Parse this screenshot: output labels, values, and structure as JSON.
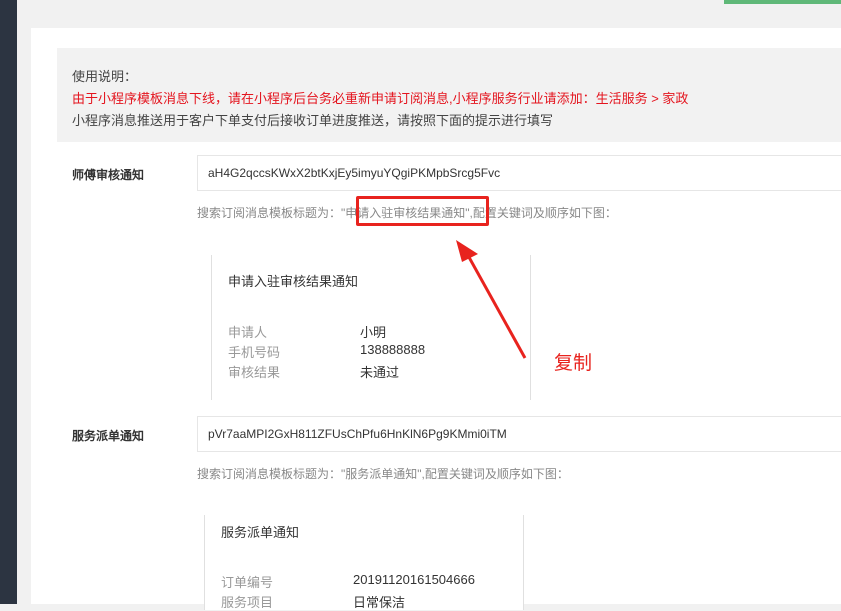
{
  "notice": {
    "line1": "使用说明：",
    "line2": "由于小程序模板消息下线，请在小程序后台务必重新申请订阅消息,小程序服务行业请添加：生活服务 > 家政",
    "line3": "小程序消息推送用于客户下单支付后接收订单进度推送，请按照下面的提示进行填写"
  },
  "audit": {
    "label": "师傅审核通知",
    "template_id": "aH4G2qccsKWxX2btKxjEy5imyuYQgiPKMpbSrcg5Fvc",
    "hint_prefix": "搜索订阅消息模板标题为：",
    "hint_title": "\"申请入驻审核结果通知\"",
    "hint_suffix": ",配置关键词及顺序如下图：",
    "card": {
      "title": "申请入驻审核结果通知",
      "rows": [
        {
          "key": "申请人",
          "value": "小明"
        },
        {
          "key": "手机号码",
          "value": "138888888"
        },
        {
          "key": "审核结果",
          "value": "未通过"
        }
      ]
    }
  },
  "dispatch": {
    "label": "服务派单通知",
    "template_id": "pVr7aaMPI2GxH811ZFUsChPfu6HnKlN6Pg9KMmi0iTM",
    "hint": "搜索订阅消息模板标题为：\"服务派单通知\",配置关键词及顺序如下图：",
    "card": {
      "title": "服务派单通知",
      "rows": [
        {
          "key": "订单编号",
          "value": "20191120161504666"
        },
        {
          "key": "服务项目",
          "value": "日常保洁"
        }
      ]
    }
  },
  "annotation": {
    "copy_note": "复制",
    "color": "#e8231e"
  }
}
